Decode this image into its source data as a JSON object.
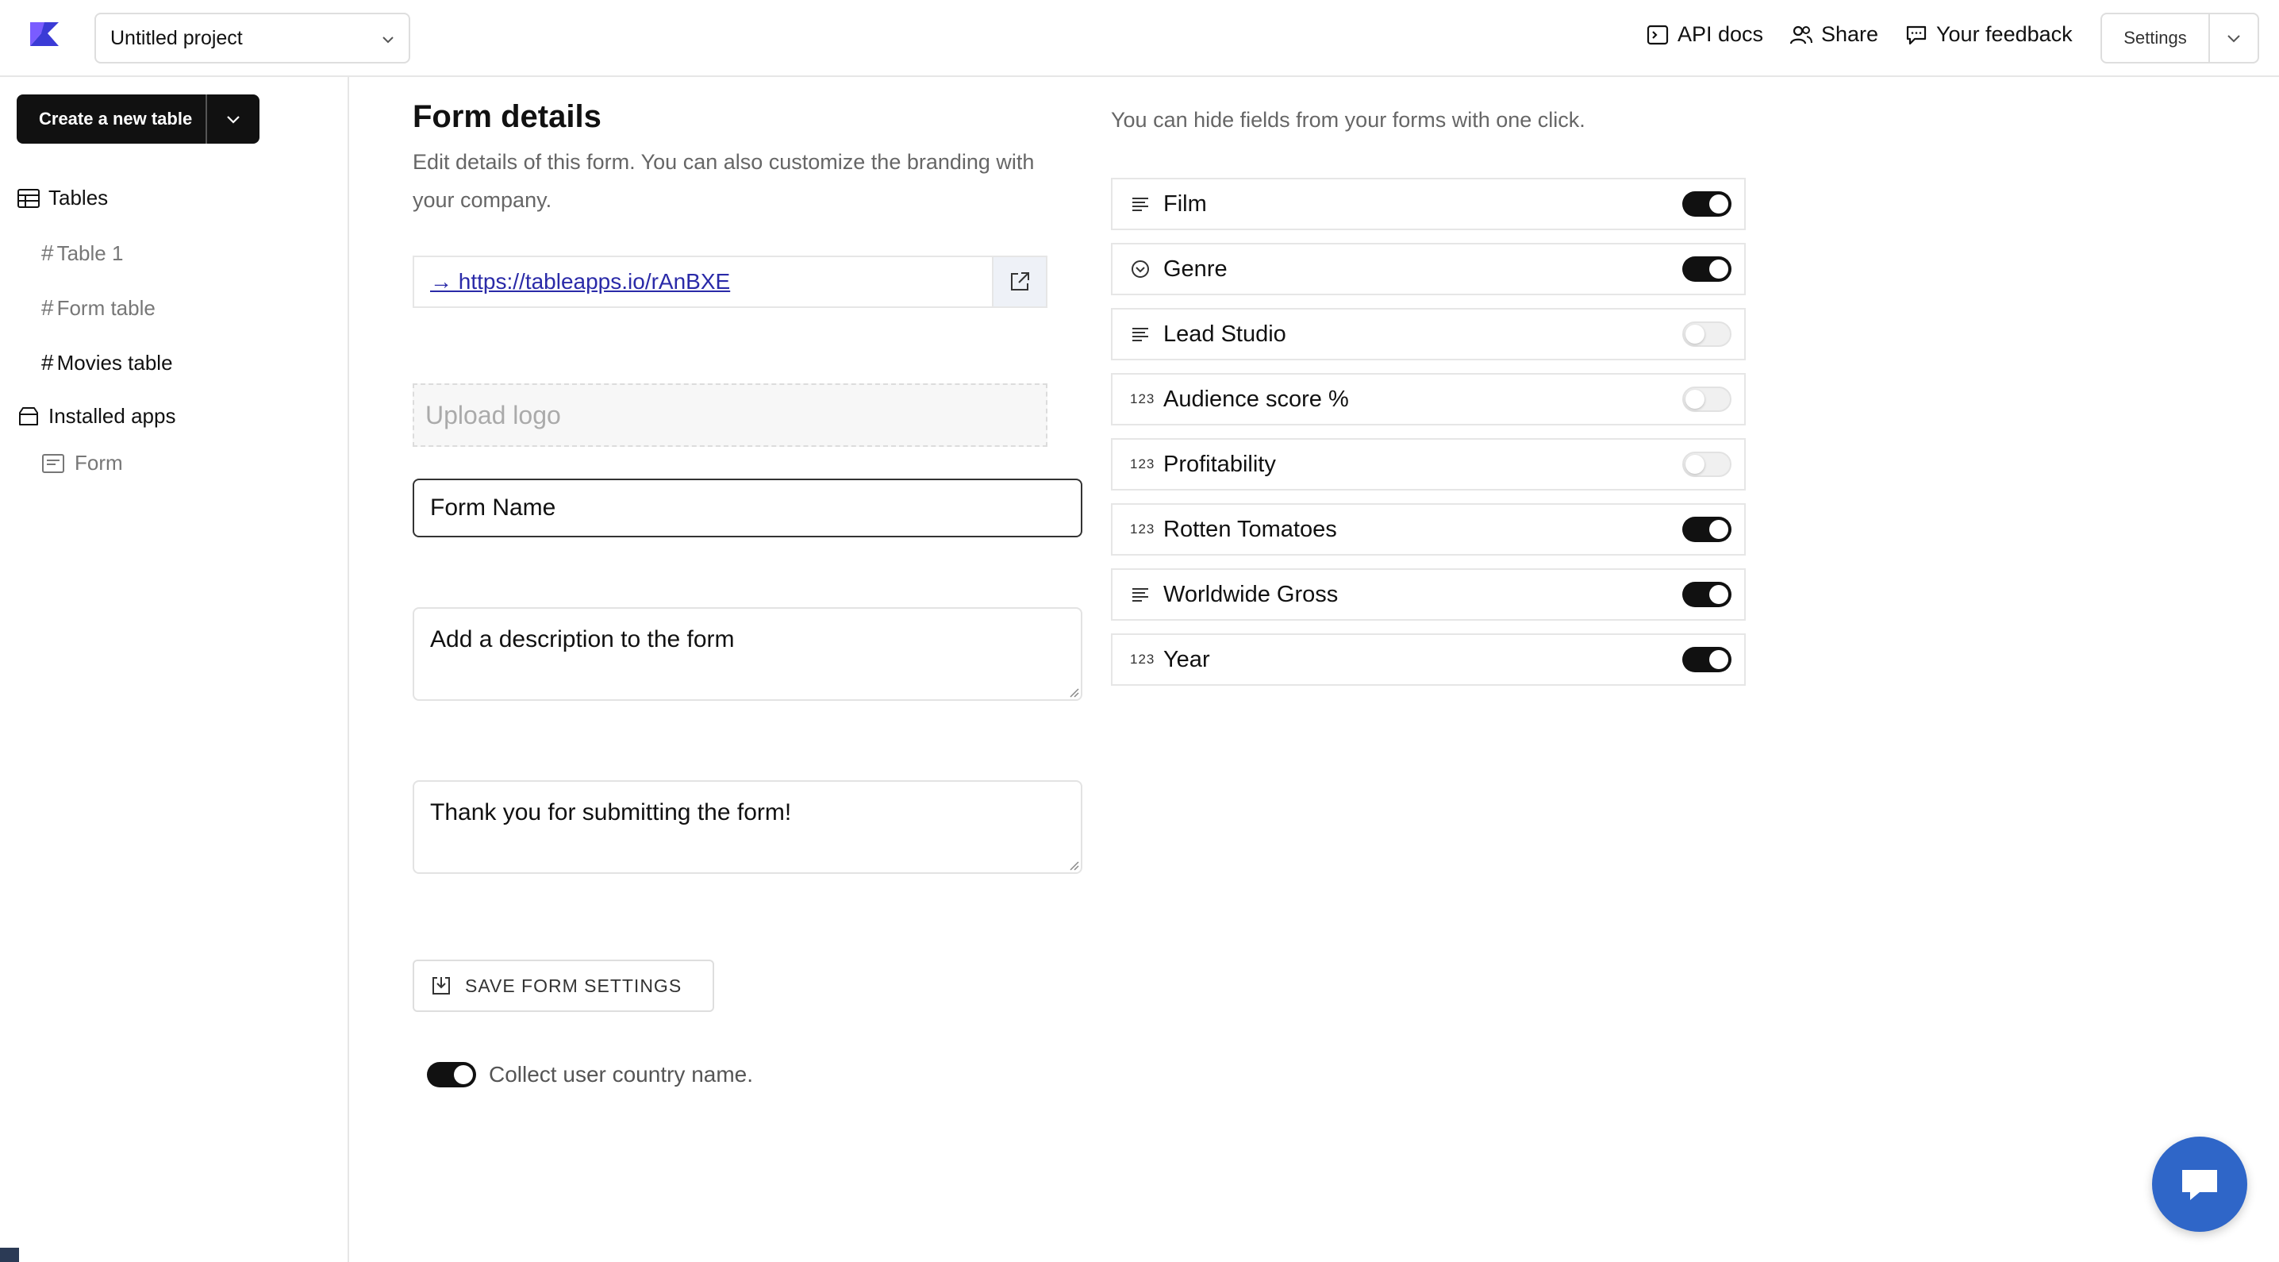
{
  "header": {
    "project": "Untitled project",
    "api_docs": "API docs",
    "share": "Share",
    "feedback": "Your feedback",
    "settings": "Settings"
  },
  "sidebar": {
    "create_button": "Create a new table",
    "tables_heading": "Tables",
    "tables": [
      {
        "label": "Table 1",
        "active": false
      },
      {
        "label": "Form table",
        "active": false
      },
      {
        "label": "Movies table",
        "active": true
      }
    ],
    "installed_heading": "Installed apps",
    "apps": [
      {
        "label": "Form"
      }
    ]
  },
  "main": {
    "title": "Form details",
    "subtitle": "Edit details of this form. You can also customize the branding with your company.",
    "link": "→ https://tableapps.io/rAnBXE",
    "upload_logo": "Upload logo",
    "form_name": "Form Name",
    "description": "Add a description to the form",
    "thanks": "Thank you for submitting the form!",
    "save_button": "SAVE FORM SETTINGS",
    "collect_country": "Collect user country name.",
    "collect_country_on": true
  },
  "fields": {
    "hint": "You can hide fields from your forms with one click.",
    "items": [
      {
        "label": "Film",
        "icon": "text-lines-icon",
        "on": true
      },
      {
        "label": "Genre",
        "icon": "select-icon",
        "on": true
      },
      {
        "label": "Lead Studio",
        "icon": "text-lines-icon",
        "on": false
      },
      {
        "label": "Audience score %",
        "icon": "number-icon",
        "on": false
      },
      {
        "label": "Profitability",
        "icon": "number-icon",
        "on": false
      },
      {
        "label": "Rotten Tomatoes",
        "icon": "number-icon",
        "on": true
      },
      {
        "label": "Worldwide Gross",
        "icon": "text-lines-icon",
        "on": true
      },
      {
        "label": "Year",
        "icon": "number-icon",
        "on": true
      }
    ],
    "number_icon_text": "123"
  },
  "colors": {
    "accent_dark": "#111111",
    "link": "#2a2aa8",
    "chat": "#2f66c8"
  }
}
